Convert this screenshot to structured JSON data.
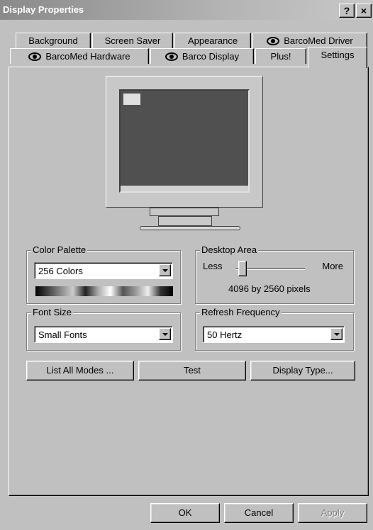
{
  "window": {
    "title": "Display Properties",
    "help_label": "?",
    "close_label": "×"
  },
  "tabs_row1": [
    {
      "label": "Background",
      "eye": false
    },
    {
      "label": "Screen Saver",
      "eye": false
    },
    {
      "label": "Appearance",
      "eye": false
    },
    {
      "label": "BarcoMed Driver",
      "eye": true
    }
  ],
  "tabs_row2": [
    {
      "label": "BarcoMed Hardware",
      "eye": true
    },
    {
      "label": "Barco Display",
      "eye": true
    },
    {
      "label": "Plus!",
      "eye": false
    },
    {
      "label": "Settings",
      "eye": false,
      "active": true
    }
  ],
  "color_palette": {
    "label": "Color Palette",
    "value": "256 Colors"
  },
  "desktop_area": {
    "label": "Desktop Area",
    "less": "Less",
    "more": "More",
    "resolution": "4096 by 2560 pixels",
    "slider_fraction": 0.1
  },
  "font_size": {
    "label": "Font Size",
    "value": "Small Fonts"
  },
  "refresh": {
    "label": "Refresh Frequency",
    "value": "50 Hertz"
  },
  "buttons": {
    "list_all_modes": "List All Modes ...",
    "test": "Test",
    "display_type": "Display Type..."
  },
  "footer": {
    "ok": "OK",
    "cancel": "Cancel",
    "apply": "Apply"
  }
}
